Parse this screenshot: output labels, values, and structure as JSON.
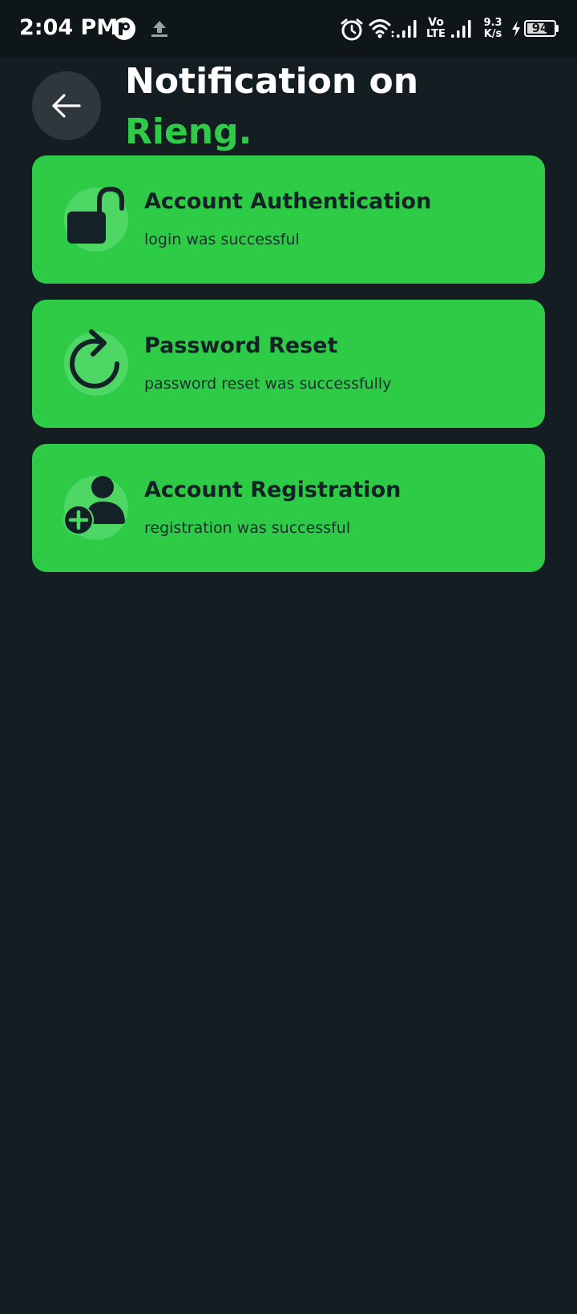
{
  "status_bar": {
    "time": "2:04 PM",
    "network_speed_value": "9.3",
    "network_speed_unit": "K/s",
    "volte_top": "Vo",
    "volte_bottom": "LTE",
    "battery_level": "94",
    "icons": [
      "app-notification-icon",
      "upload-icon",
      "alarm-icon",
      "wifi-icon",
      "signal-icon",
      "volte-icon",
      "signal-icon",
      "charging-icon",
      "battery-icon"
    ]
  },
  "header": {
    "back_icon": "arrow-left-icon",
    "title": "Notification on",
    "brand": "Rieng."
  },
  "notifications": [
    {
      "icon": "unlock-icon",
      "title": "Account Authentication",
      "subtitle": "login was successful"
    },
    {
      "icon": "refresh-icon",
      "title": "Password Reset",
      "subtitle": "password reset was successfully"
    },
    {
      "icon": "add-user-icon",
      "title": "Account Registration",
      "subtitle": "registration was successful"
    }
  ],
  "colors": {
    "background": "#131d22",
    "status_bar": "#0e1619",
    "accent": "#2ecc46",
    "card_icon_circle": "#4ed765",
    "card_text": "#142228",
    "back_button": "#2d373c"
  }
}
